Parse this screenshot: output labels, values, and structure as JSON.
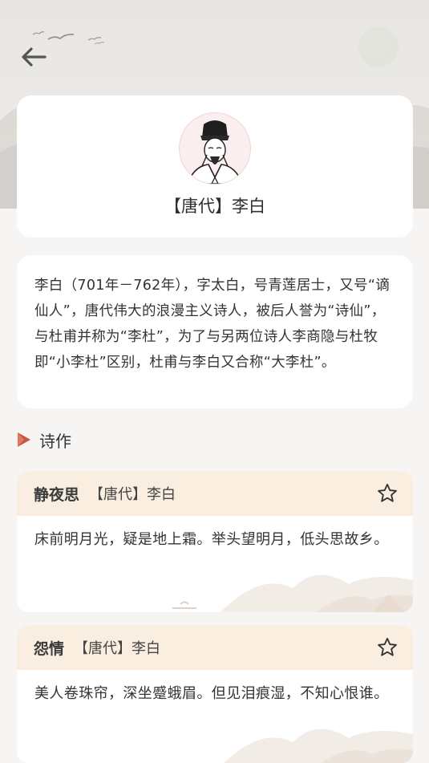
{
  "author": {
    "name": "【唐代】李白"
  },
  "intro": {
    "text": "李白（701年－762年），字太白，号青莲居士，又号“谪仙人”，唐代伟大的浪漫主义诗人，被后人誉为“诗仙”，与杜甫并称为“李杜”，为了与另两位诗人李商隐与杜牧即“小李杜”区别，杜甫与李白又合称“大李杜”。"
  },
  "section": {
    "title": "诗作"
  },
  "poems": [
    {
      "title": "静夜思",
      "meta": "【唐代】李白",
      "text": "床前明月光，疑是地上霜。举头望明月，低头思故乡。"
    },
    {
      "title": "怨情",
      "meta": "【唐代】李白",
      "text": "美人卷珠帘，深坐蹙蛾眉。但见泪痕湿，不知心恨谁。"
    }
  ],
  "icons": {
    "back": "arrow-left-icon",
    "favorite": "star-outline-icon",
    "section": "triangle-play-icon"
  },
  "colors": {
    "accent": "#c8553d",
    "poem_header": "#f9eee0",
    "background": "#f6f5f4"
  }
}
